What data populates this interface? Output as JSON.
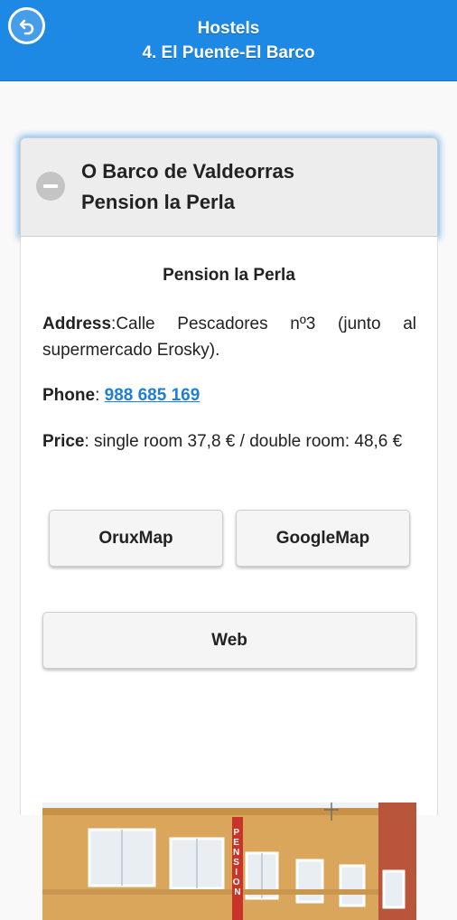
{
  "header": {
    "title_line1": "Hostels",
    "title_line2": "4. El Puente-El Barco",
    "back_icon": "back-arrow-icon",
    "background_color": "#1e88e5"
  },
  "collapsible": {
    "heading_line1": "O Barco de Valdeorras",
    "heading_line2": "Pension la Perla",
    "state_icon": "minus-icon",
    "expanded": true
  },
  "hostel": {
    "name": "Pension la Perla",
    "address_label": "Address",
    "address_value": "Calle Pescadores nº3 (junto al supermercado Erosky).",
    "phone_label": "Phone",
    "phone_value": "988 685 169",
    "price_label": "Price",
    "price_value": "single room 37,8 € / double room: 48,6 €"
  },
  "buttons": {
    "oruxmap": "OruxMap",
    "googlemap": "GoogleMap",
    "web": "Web"
  },
  "photo": {
    "sign_text": "PENSION"
  },
  "colors": {
    "link": "#1e7fd6",
    "highlight": "#7ab8ee"
  }
}
